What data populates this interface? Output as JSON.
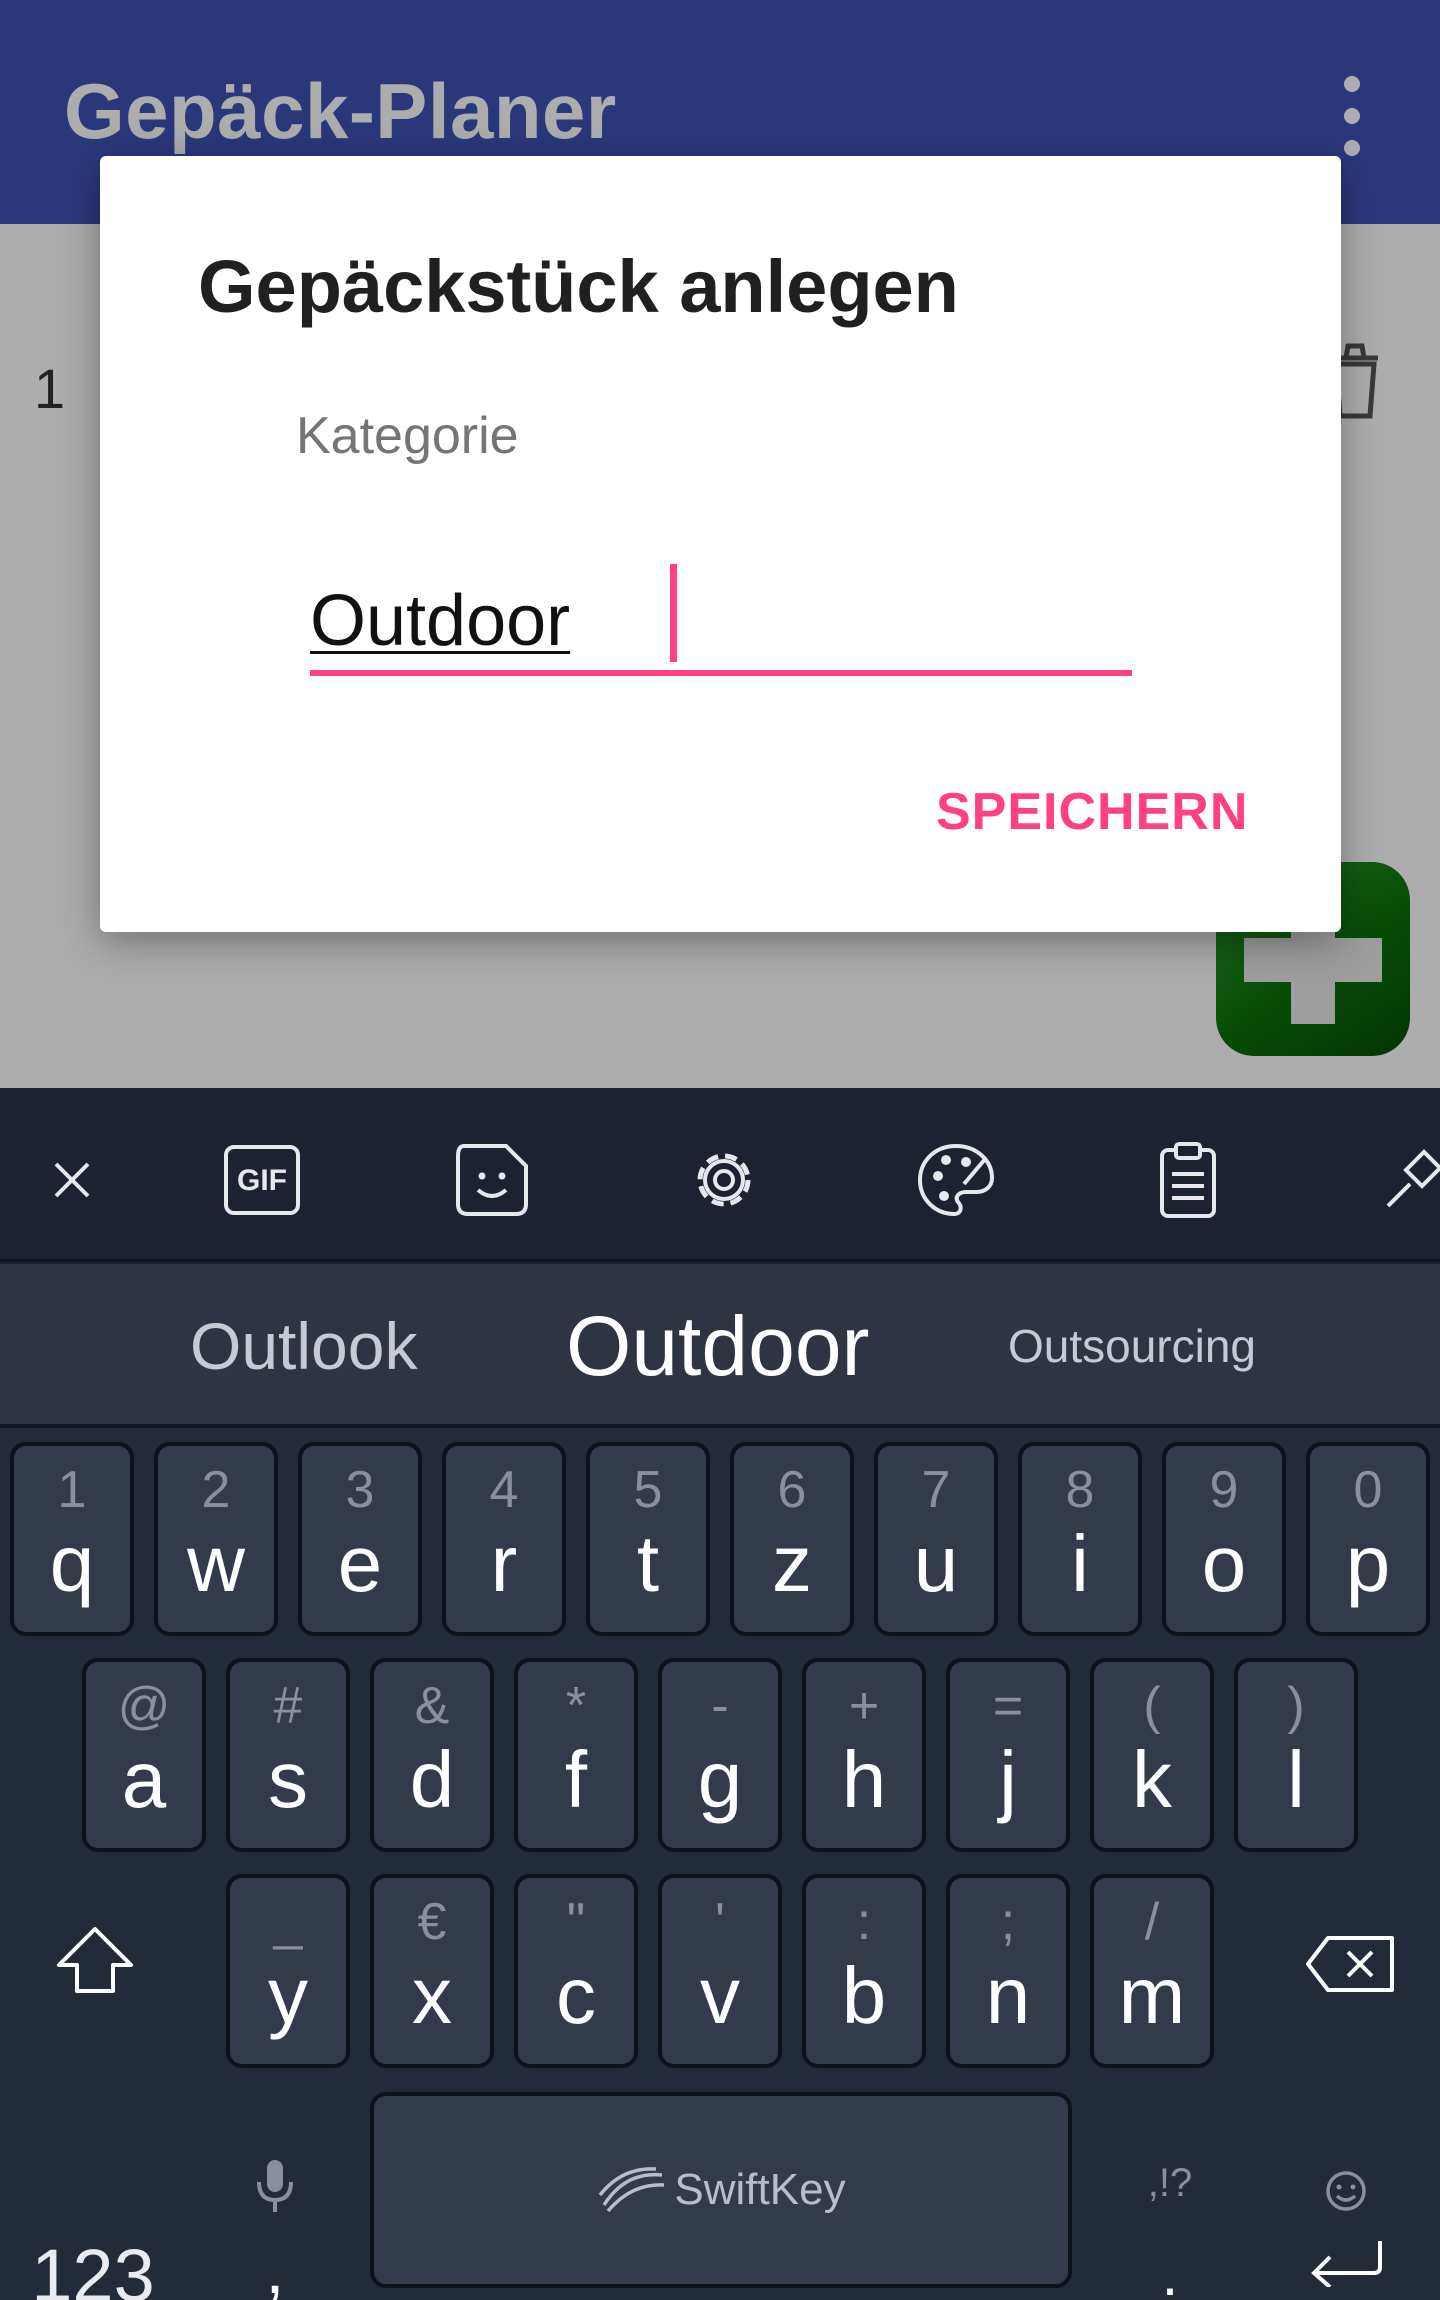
{
  "app": {
    "title": "Gepäck-Planer",
    "list_count": "1",
    "accent_color": "#3f51b5",
    "fab_color": "#1b8a1b"
  },
  "dialog": {
    "title": "Gepäckstück anlegen",
    "field_label": "Kategorie",
    "field_value": "Outdoor",
    "save_label": "SPEICHERN",
    "accent_color": "#ff4081"
  },
  "keyboard": {
    "toolbar_icons": [
      "close-icon",
      "gif-icon",
      "sticker-icon",
      "settings-icon",
      "theme-palette-icon",
      "clipboard-icon",
      "pin-icon"
    ],
    "gif_label": "GIF",
    "suggestions": [
      "Outlook",
      "Outdoor",
      "Outsourcing"
    ],
    "row1": [
      {
        "hint": "1",
        "key": "q"
      },
      {
        "hint": "2",
        "key": "w"
      },
      {
        "hint": "3",
        "key": "e"
      },
      {
        "hint": "4",
        "key": "r"
      },
      {
        "hint": "5",
        "key": "t"
      },
      {
        "hint": "6",
        "key": "z"
      },
      {
        "hint": "7",
        "key": "u"
      },
      {
        "hint": "8",
        "key": "i"
      },
      {
        "hint": "9",
        "key": "o"
      },
      {
        "hint": "0",
        "key": "p"
      }
    ],
    "row2": [
      {
        "hint": "@",
        "key": "a"
      },
      {
        "hint": "#",
        "key": "s"
      },
      {
        "hint": "&",
        "key": "d"
      },
      {
        "hint": "*",
        "key": "f"
      },
      {
        "hint": "-",
        "key": "g"
      },
      {
        "hint": "+",
        "key": "h"
      },
      {
        "hint": "=",
        "key": "j"
      },
      {
        "hint": "(",
        "key": "k"
      },
      {
        "hint": ")",
        "key": "l"
      }
    ],
    "row3": [
      {
        "hint": "_",
        "key": "y"
      },
      {
        "hint": "€",
        "key": "x"
      },
      {
        "hint": "\"",
        "key": "c"
      },
      {
        "hint": "'",
        "key": "v"
      },
      {
        "hint": ":",
        "key": "b"
      },
      {
        "hint": ";",
        "key": "n"
      },
      {
        "hint": "/",
        "key": "m"
      }
    ],
    "numbers_label": "123",
    "comma_label": ",",
    "space_label": "SwiftKey",
    "punct_hint": ",!?",
    "period_label": "."
  }
}
